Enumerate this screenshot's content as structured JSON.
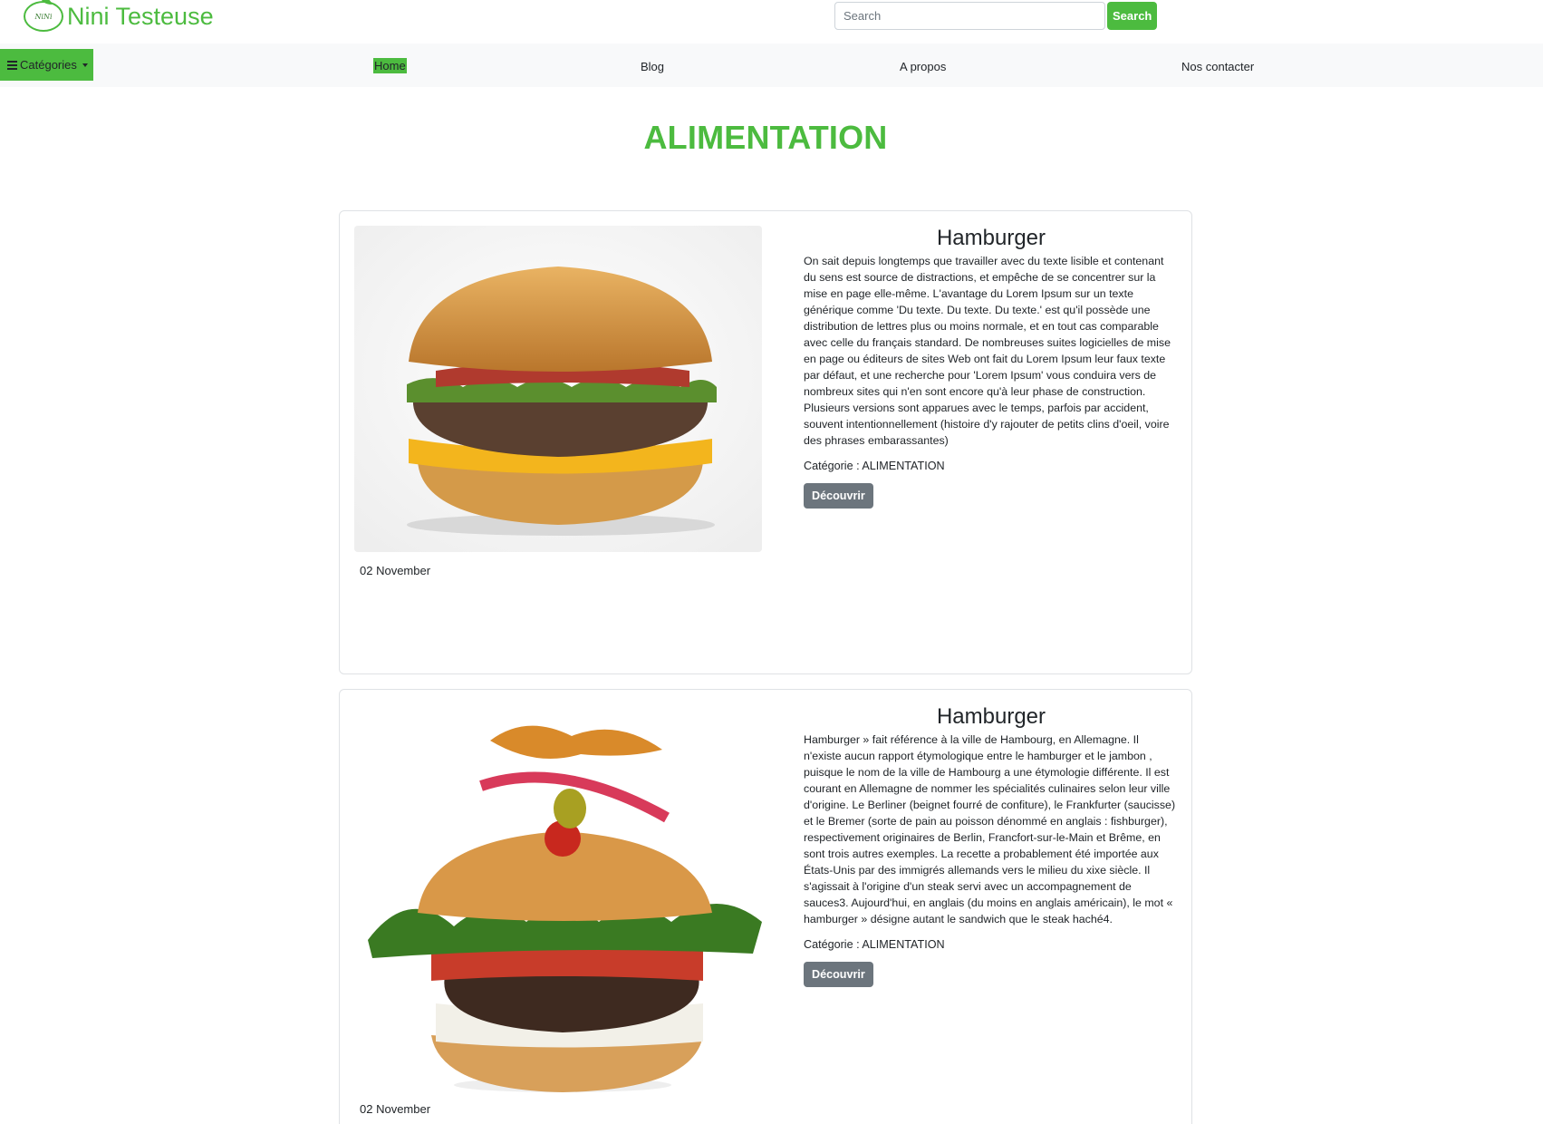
{
  "header": {
    "brand": "Nini Testeuse",
    "logo_text": "NiNi",
    "search": {
      "placeholder": "Search",
      "button_label": "Search"
    }
  },
  "nav": {
    "categories_label": "Catégories",
    "items": [
      {
        "label": "Home",
        "active": true
      },
      {
        "label": "Blog"
      },
      {
        "label": "A propos"
      },
      {
        "label": "Nos contacter"
      }
    ]
  },
  "page": {
    "title": "ALIMENTATION"
  },
  "articles": [
    {
      "title": "Hamburger",
      "text": "On sait depuis longtemps que travailler avec du texte lisible et contenant du sens est source de distractions, et empêche de se concentrer sur la mise en page elle-même. L'avantage du Lorem Ipsum sur un texte générique comme 'Du texte. Du texte. Du texte.' est qu'il possède une distribution de lettres plus ou moins normale, et en tout cas comparable avec celle du français standard. De nombreuses suites logicielles de mise en page ou éditeurs de sites Web ont fait du Lorem Ipsum leur faux texte par défaut, et une recherche pour 'Lorem Ipsum' vous conduira vers de nombreux sites qui n'en sont encore qu'à leur phase de construction. Plusieurs versions sont apparues avec le temps, parfois par accident, souvent intentionnellement (histoire d'y rajouter de petits clins d'oeil, voire des phrases embarassantes)",
      "category": "Catégorie : ALIMENTATION",
      "button_label": "Découvrir",
      "date": "02 November"
    },
    {
      "title": "Hamburger",
      "text": "Hamburger » fait référence à la ville de Hambourg, en Allemagne. Il n'existe aucun rapport étymologique entre le hamburger et le jambon , puisque le nom de la ville de Hambourg a une étymologie différente. Il est courant en Allemagne de nommer les spécialités culinaires selon leur ville d'origine. Le Berliner (beignet fourré de confiture), le Frankfurter (saucisse) et le Bremer (sorte de pain au poisson dénommé en anglais : fishburger), respectivement originaires de Berlin, Francfort-sur-le-Main et Brême, en sont trois autres exemples. La recette a probablement été importée aux États-Unis par des immigrés allemands vers le milieu du xixe siècle. Il s'agissait à l'origine d'un steak servi avec un accompagnement de sauces3. Aujourd'hui, en anglais (du moins en anglais américain), le mot « hamburger » désigne autant le sandwich que le steak haché4.",
      "category": "Catégorie : ALIMENTATION",
      "button_label": "Découvrir",
      "date": "02 November"
    }
  ],
  "colors": {
    "brand_green": "#4cbb3f",
    "nav_bg": "#f8f9fa",
    "button_gray": "#6c757d"
  }
}
